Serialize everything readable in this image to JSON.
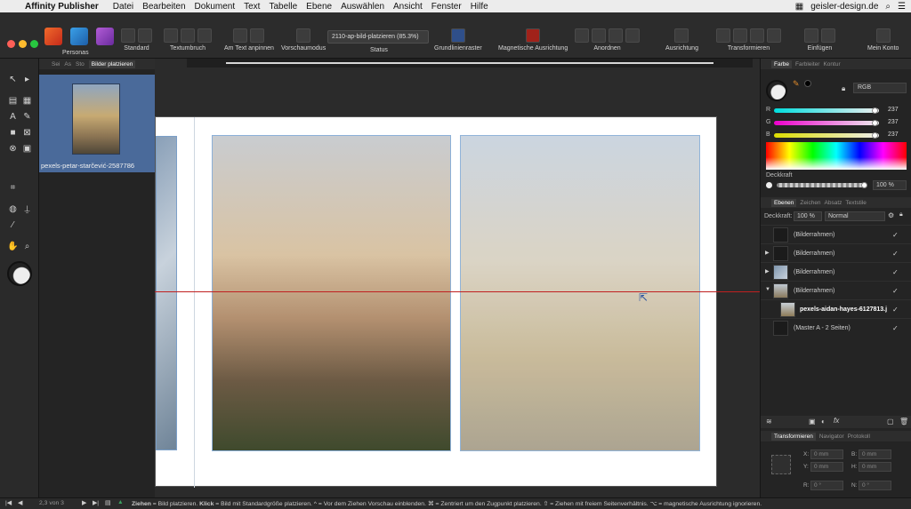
{
  "menubar": {
    "app_name": "Affinity Publisher",
    "items": [
      "Datei",
      "Bearbeiten",
      "Dokument",
      "Text",
      "Tabelle",
      "Ebene",
      "Auswählen",
      "Ansicht",
      "Fenster",
      "Hilfe"
    ],
    "right_text": "geisler-design.de"
  },
  "toolbar": {
    "personas_label": "Personas",
    "groups": [
      {
        "label": "Standard"
      },
      {
        "label": "Textumbruch"
      },
      {
        "label": "Am Text anpinnen"
      },
      {
        "label": "Vorschaumodus"
      },
      {
        "label": "Grundlinienraster"
      },
      {
        "label": "Magnetische Ausrichtung"
      },
      {
        "label": "Anordnen"
      },
      {
        "label": "Ausrichtung"
      },
      {
        "label": "Transformieren"
      },
      {
        "label": "Einfügen"
      },
      {
        "label": "Mein Konto"
      }
    ],
    "status_value": "2110-ap-bild-platzieren (85.3%)",
    "status_label": "Status"
  },
  "left_panel": {
    "tabs": [
      "Sei",
      "As",
      "Sto",
      "Bilder platzieren"
    ],
    "active_tab": "Bilder platzieren",
    "image_label": "pexels-petar-starčević-2587786"
  },
  "right_panel": {
    "color_tabs": [
      "Farbe",
      "Farbleiter",
      "Kontur"
    ],
    "color_mode": "RGB",
    "channels": [
      {
        "label": "R",
        "value": "237"
      },
      {
        "label": "G",
        "value": "237"
      },
      {
        "label": "B",
        "value": "237"
      }
    ],
    "opacity_label": "Deckkraft",
    "opacity_value": "100 %",
    "layer_tabs": [
      "Ebenen",
      "Zeichen",
      "Absatz",
      "Textstile"
    ],
    "layer_opacity_label": "Deckkraft:",
    "layer_opacity_value": "100 %",
    "blend_mode": "Normal",
    "layers": [
      {
        "name": "(Bilderrahmen)",
        "arrow": ""
      },
      {
        "name": "(Bilderrahmen)",
        "arrow": "▶"
      },
      {
        "name": "(Bilderrahmen)",
        "arrow": "▶"
      },
      {
        "name": "(Bilderrahmen)",
        "arrow": "▼"
      },
      {
        "name": "pexels-aidan-hayes-6127813.j",
        "arrow": ""
      },
      {
        "name": "(Master A - 2 Seiten)",
        "arrow": ""
      }
    ],
    "transform_tabs": [
      "Transformieren",
      "Navigator",
      "Protokoll"
    ],
    "fields": [
      {
        "label": "X:",
        "value": "0 mm"
      },
      {
        "label": "B:",
        "value": "0 mm"
      },
      {
        "label": "Y:",
        "value": "0 mm"
      },
      {
        "label": "H:",
        "value": "0 mm"
      },
      {
        "label": "R:",
        "value": "0 °"
      },
      {
        "label": "N:",
        "value": "0 °"
      }
    ]
  },
  "statusbar": {
    "page_info": "2,3 von 3",
    "hint_bold1": "Ziehen",
    "hint_text1": " = Bild platzieren. ",
    "hint_bold2": "Klick",
    "hint_text2": " = Bild mit Standardgröße platzieren. ^ = Vor dem Ziehen Vorschau einblenden. ⌘ = Zentriert um den Zugpunkt platzieren. ⇧ = Ziehen mit freiem Seitenverhältnis. ⌥ = magnetische Ausrichtung ignorieren."
  },
  "colors": {
    "accent": "#4a6a9a",
    "guide": "#c02020"
  }
}
